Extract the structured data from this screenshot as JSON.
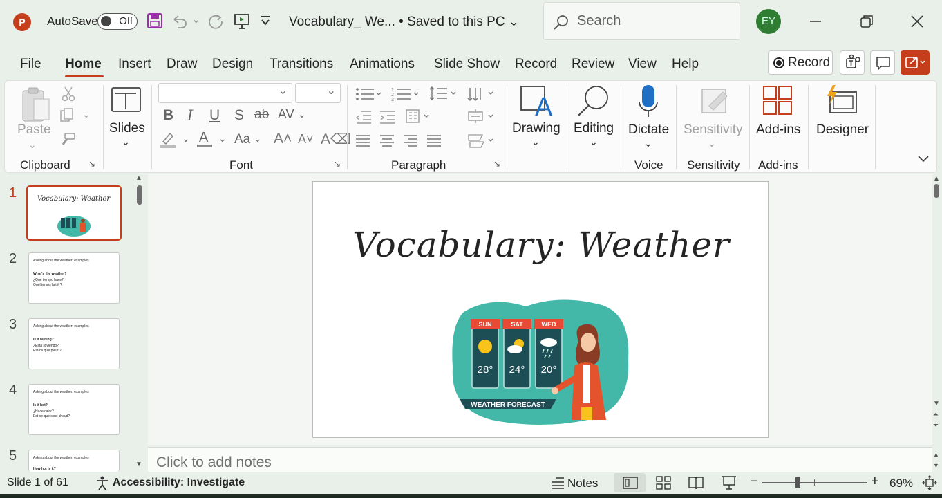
{
  "titlebar": {
    "app_logo": "P",
    "autosave_label": "AutoSave",
    "autosave_state": "Off",
    "doc_title": "Vocabulary_ We... • Saved to this PC",
    "search_placeholder": "Search",
    "user_initials": "EY"
  },
  "menu": {
    "tabs": [
      "File",
      "Home",
      "Insert",
      "Draw",
      "Design",
      "Transitions",
      "Animations",
      "Slide Show",
      "Record",
      "Review",
      "View",
      "Help"
    ],
    "active_tab": "Home",
    "record_label": "Record"
  },
  "ribbon": {
    "paste_label": "Paste",
    "clipboard_label": "Clipboard",
    "slides_label": "Slides",
    "font_label": "Font",
    "paragraph_label": "Paragraph",
    "drawing_label": "Drawing",
    "editing_label": "Editing",
    "dictate_label": "Dictate",
    "voice_label": "Voice",
    "sensitivity_label": "Sensitivity",
    "sensitivity_group_label": "Sensitivity",
    "addins_label": "Add-ins",
    "addins_group_label": "Add-ins",
    "designer_label": "Designer",
    "font_buttons": [
      "B",
      "I",
      "U",
      "S",
      "ab",
      "AV"
    ],
    "case_label": "Aa"
  },
  "thumbnails": [
    {
      "num": "1",
      "title": "Vocabulary: Weather"
    },
    {
      "num": "2",
      "l1": "Asking about the weather: examples",
      "l2": "What's the weather?",
      "l3": "¿Qué tiempo hace?",
      "l4": "Quel temps fait-il ?"
    },
    {
      "num": "3",
      "l1": "Asking about the weather: examples",
      "l2": "Is it raining?",
      "l3": "¿Está lloviendo?",
      "l4": "Est-ce qu'il pleut ?"
    },
    {
      "num": "4",
      "l1": "Asking about the weather: examples",
      "l2": "Is it hot?",
      "l3": "¿Hace calor?",
      "l4": "Est-ce que c'est chaud?"
    },
    {
      "num": "5",
      "l1": "Asking about the weather: examples",
      "l2": "How hot is it?"
    }
  ],
  "slide": {
    "title": "Vocabulary: Weather",
    "forecast": [
      {
        "day": "SUN",
        "temp": "28°"
      },
      {
        "day": "SAT",
        "temp": "24°"
      },
      {
        "day": "WED",
        "temp": "20°"
      }
    ],
    "banner": "WEATHER FORECAST"
  },
  "notes": {
    "placeholder": "Click to add notes"
  },
  "statusbar": {
    "slide_info": "Slide 1 of 61",
    "accessibility": "Accessibility: Investigate",
    "notes_label": "Notes",
    "zoom": "69%"
  },
  "colors": {
    "accent": "#c43e1c",
    "teal": "#44b8a8",
    "panel": "#1d4e56"
  }
}
